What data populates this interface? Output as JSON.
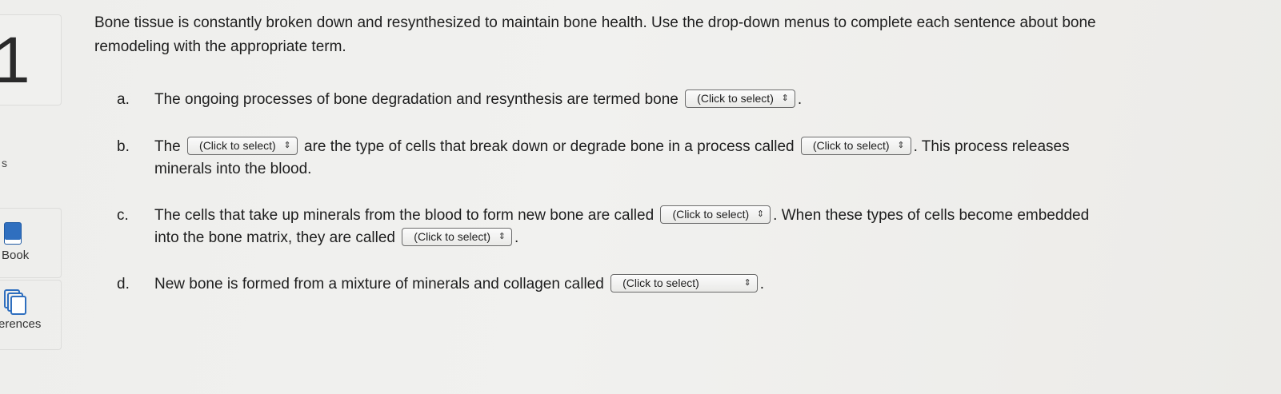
{
  "question_number": "1",
  "rail": {
    "s_label": "s",
    "book_label": "Book",
    "references_label": "erences"
  },
  "intro": "Bone tissue is constantly broken down and resynthesized to maintain bone health. Use the drop-down menus to complete each sentence about bone remodeling with the appropriate term.",
  "dropdown_placeholder": "(Click to select)",
  "items": {
    "a": {
      "letter": "a.",
      "text1": "The ongoing processes of bone degradation and resynthesis are termed bone",
      "text2": "."
    },
    "b": {
      "letter": "b.",
      "text1": "The",
      "text2": "are the type of cells that break down or degrade bone in a process called",
      "text3": ". This process releases minerals into the blood."
    },
    "c": {
      "letter": "c.",
      "text1": "The cells that take up minerals from the blood to form new bone are called",
      "text2": ". When these types of cells become embedded into the bone matrix, they are called",
      "text3": "."
    },
    "d": {
      "letter": "d.",
      "text1": "New bone is formed from a mixture of minerals and collagen called",
      "text2": "."
    }
  }
}
